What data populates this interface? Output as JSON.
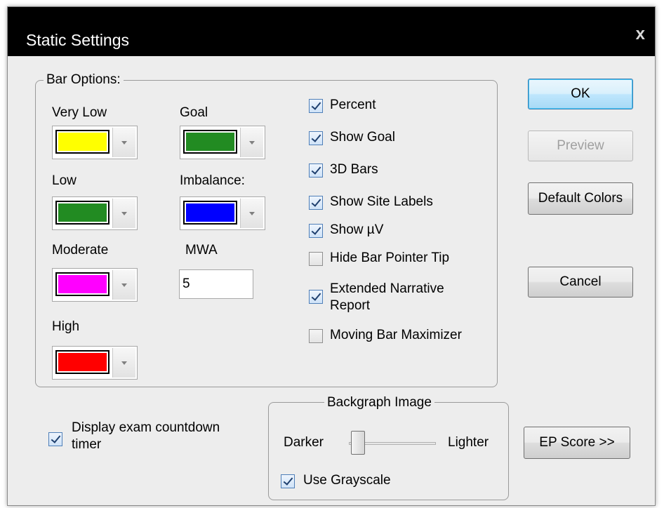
{
  "dialog": {
    "title": "Static Settings",
    "close_label": "x"
  },
  "bar_options": {
    "title": "Bar Options:",
    "colors": [
      {
        "label": "Very Low",
        "color": "#ffff00"
      },
      {
        "label": "Goal",
        "color": "#228b22"
      },
      {
        "label": "Low",
        "color": "#228b22"
      },
      {
        "label": "Imbalance:",
        "color": "#0000ff"
      },
      {
        "label": "Moderate",
        "color": "#ff00ff"
      },
      {
        "label": "High",
        "color": "#ff0000"
      }
    ],
    "mwa": {
      "label": "MWA",
      "value": "5"
    },
    "checkboxes": [
      {
        "label": "Percent",
        "checked": true
      },
      {
        "label": "Show Goal",
        "checked": true
      },
      {
        "label": "3D Bars",
        "checked": true
      },
      {
        "label": "Show Site Labels",
        "checked": true
      },
      {
        "label": "Show µV",
        "checked": true
      },
      {
        "label": "Hide Bar Pointer Tip",
        "checked": false
      },
      {
        "label": "Extended Narrative Report",
        "label_line1": "Extended Narrative",
        "label_line2": "Report",
        "checked": true
      },
      {
        "label": "Moving Bar Maximizer",
        "checked": false
      }
    ]
  },
  "buttons": {
    "ok": "OK",
    "preview": "Preview",
    "default_colors": "Default Colors",
    "cancel": "Cancel",
    "ep_score": "EP Score >>"
  },
  "countdown": {
    "label": "Display exam countdown timer",
    "label_line1": "Display exam countdown",
    "label_line2": "timer",
    "checked": true
  },
  "backgraph": {
    "title": "Backgraph Image",
    "darker_label": "Darker",
    "lighter_label": "Lighter",
    "slider_level": 0.1,
    "grayscale_label": "Use Grayscale",
    "grayscale_checked": true
  }
}
